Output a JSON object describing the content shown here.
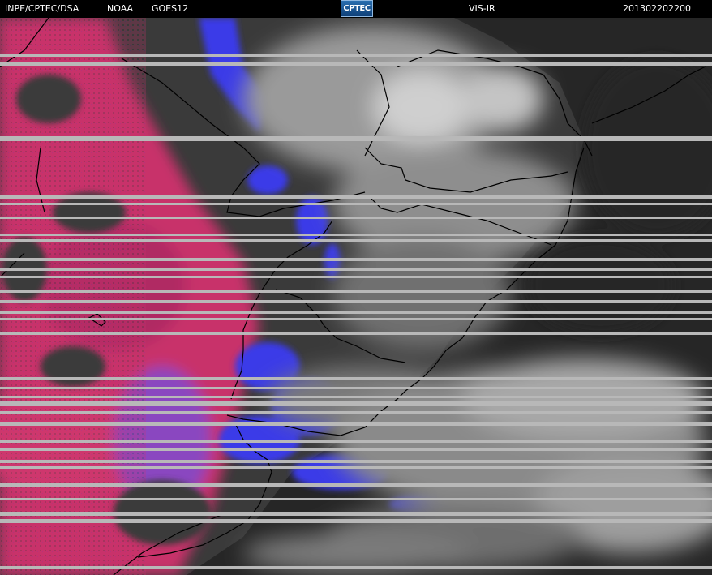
{
  "header": {
    "agency": "INPE/CPTEC/DSA",
    "source": "NOAA",
    "satellite": "GOES12",
    "logo_text": "CPTEC",
    "channel": "VIS-IR",
    "timestamp": "201302202200"
  },
  "colors": {
    "background": "#000000",
    "land": "#3a3a3a",
    "ocean": "#262626",
    "cold_cloud_magenta": "#c8336a",
    "cold_cloud_blue": "#3a3ae8",
    "warm_cloud_gray": "#b4b4b4",
    "scan_line": "#b8b8b8",
    "coastline": "#000000"
  },
  "imagery": {
    "scan_line_count": 38
  }
}
